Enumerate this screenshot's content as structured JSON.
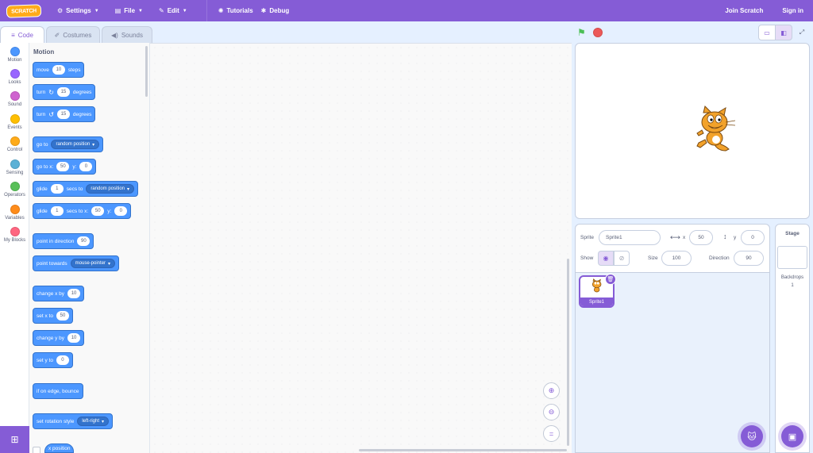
{
  "menubar": {
    "logo": "SCRATCH",
    "settings": "Settings",
    "file": "File",
    "edit": "Edit",
    "tutorials": "Tutorials",
    "debug": "Debug",
    "join": "Join Scratch",
    "signin": "Sign in"
  },
  "tabs": {
    "code": "Code",
    "costumes": "Costumes",
    "sounds": "Sounds"
  },
  "categories": [
    {
      "label": "Motion",
      "color": "#4c97ff"
    },
    {
      "label": "Looks",
      "color": "#9966ff"
    },
    {
      "label": "Sound",
      "color": "#cf63cf"
    },
    {
      "label": "Events",
      "color": "#ffbf00"
    },
    {
      "label": "Control",
      "color": "#ffab19"
    },
    {
      "label": "Sensing",
      "color": "#5cb1d6"
    },
    {
      "label": "Operators",
      "color": "#59c059"
    },
    {
      "label": "Variables",
      "color": "#ff8c1a"
    },
    {
      "label": "My Blocks",
      "color": "#ff6680"
    }
  ],
  "palette": {
    "title": "Motion",
    "move": {
      "t1": "move",
      "v": "10",
      "t2": "steps"
    },
    "turn_right": {
      "t1": "turn",
      "v": "15",
      "t2": "degrees"
    },
    "turn_left": {
      "t1": "turn",
      "v": "15",
      "t2": "degrees"
    },
    "goto": {
      "t1": "go to",
      "dd": "random position"
    },
    "goto_xy": {
      "t1": "go to x:",
      "x": "50",
      "t2": "y:",
      "y": "0"
    },
    "glide": {
      "t1": "glide",
      "v": "1",
      "t2": "secs to",
      "dd": "random position"
    },
    "glide_xy": {
      "t1": "glide",
      "v": "1",
      "t2": "secs to x:",
      "x": "50",
      "t3": "y:",
      "y": "0"
    },
    "point_dir": {
      "t1": "point in direction",
      "v": "90"
    },
    "point_towards": {
      "t1": "point towards",
      "dd": "mouse-pointer"
    },
    "change_x": {
      "t1": "change x by",
      "v": "10"
    },
    "set_x": {
      "t1": "set x to",
      "v": "50"
    },
    "change_y": {
      "t1": "change y by",
      "v": "10"
    },
    "set_y": {
      "t1": "set y to",
      "v": "0"
    },
    "bounce": {
      "t1": "if on edge, bounce"
    },
    "rotation": {
      "t1": "set rotation style",
      "dd": "left-right"
    },
    "xpos": {
      "t1": "x position"
    }
  },
  "sprite": {
    "label": "Sprite",
    "name": "Sprite1",
    "x_label": "x",
    "x": "50",
    "y_label": "y",
    "y": "0",
    "show_label": "Show",
    "size_label": "Size",
    "size": "100",
    "direction_label": "Direction",
    "direction": "90",
    "thumb_name": "Sprite1"
  },
  "stagepane": {
    "title": "Stage",
    "backdrops_label": "Backdrops",
    "backdrops_count": "1"
  }
}
